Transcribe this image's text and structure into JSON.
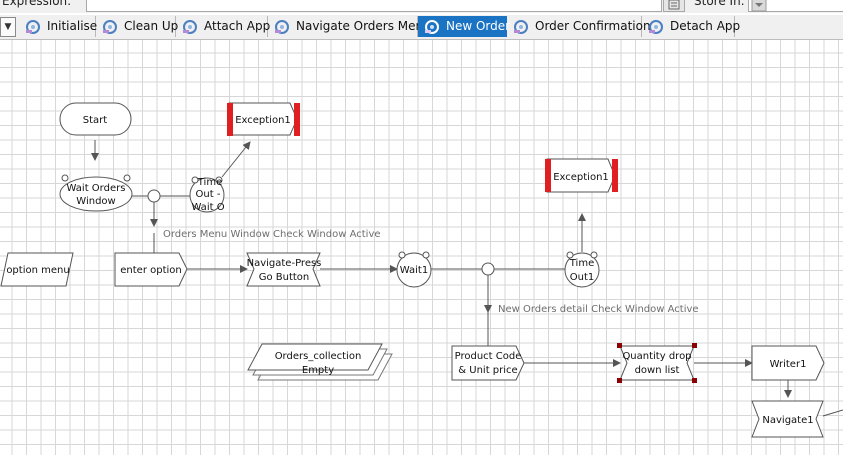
{
  "header": {
    "expression_label": "Expression:",
    "store_in_label": "Store In:"
  },
  "tabs": [
    {
      "label": "Initialise"
    },
    {
      "label": "Clean Up"
    },
    {
      "label": "Attach App"
    },
    {
      "label": "Navigate Orders Menu"
    },
    {
      "label": "New Order",
      "active": true
    },
    {
      "label": "Order Confirmation"
    },
    {
      "label": "Detach App"
    }
  ],
  "flow": {
    "start": "Start",
    "wait_orders": [
      "Wait Orders",
      "Window"
    ],
    "timeout_wait": [
      "Time",
      "Out -",
      "Wait O"
    ],
    "exception_1": "Exception1",
    "exception_2": "Exception1",
    "orders_menu_label": "Orders Menu Window Check Window Active",
    "option_menu": "option menu",
    "enter_option": "enter option",
    "navigate_press": [
      "Navigate-Press",
      "Go Button"
    ],
    "wait1": "Wait1",
    "timeout1": [
      "Time",
      "Out1"
    ],
    "new_orders_label": "New Orders detail Check Window Active",
    "orders_collection": [
      "Orders_collection",
      "Empty"
    ],
    "product_code": [
      "Product Code",
      "& Unit price"
    ],
    "quantity_drop": [
      "Quantity drop",
      "down list"
    ],
    "writer1": "Writer1",
    "navigate1": "Navigate1"
  },
  "colors": {
    "active_tab": "#1b73c4",
    "exception_bar": "#e02020"
  }
}
